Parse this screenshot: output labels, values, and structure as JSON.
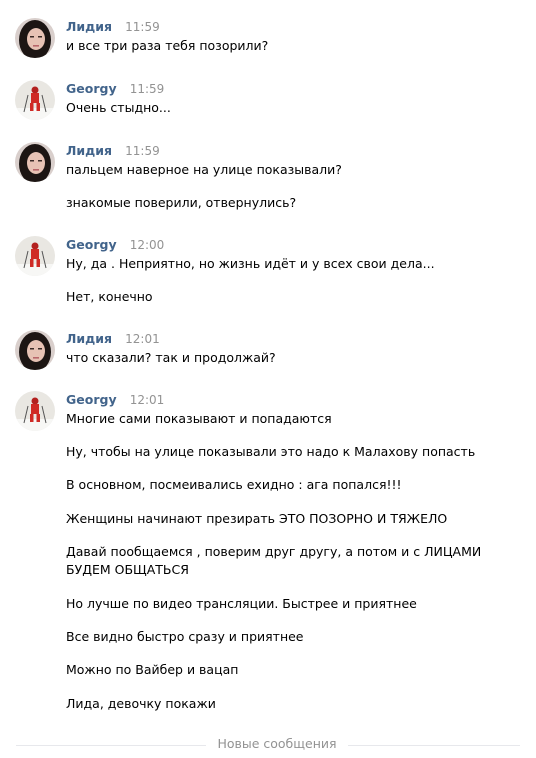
{
  "messages": [
    {
      "author": "Лидия",
      "time": "11:59",
      "avatar_icon": "avatar-woman-icon",
      "lines": [
        "и все три раза тебя позорили?"
      ]
    },
    {
      "author": "Georgy",
      "time": "11:59",
      "avatar_icon": "avatar-skier-icon",
      "lines": [
        "Очень стыдно..."
      ]
    },
    {
      "author": "Лидия",
      "time": "11:59",
      "avatar_icon": "avatar-woman-icon",
      "lines": [
        "пальцем наверное на улице показывали?",
        "знакомые поверили, отвернулись?"
      ]
    },
    {
      "author": "Georgy",
      "time": "12:00",
      "avatar_icon": "avatar-skier-icon",
      "lines": [
        "Ну, да . Неприятно, но жизнь идёт и у всех свои дела...",
        "Нет, конечно"
      ]
    },
    {
      "author": "Лидия",
      "time": "12:01",
      "avatar_icon": "avatar-woman-icon",
      "lines": [
        "что сказали? так и продолжай?"
      ]
    },
    {
      "author": "Georgy",
      "time": "12:01",
      "avatar_icon": "avatar-skier-icon",
      "lines": [
        "Многие сами показывают и попадаются",
        "Ну, чтобы на улице показывали это надо к Малахову попасть",
        "В основном, посмеивались ехидно : ага попался!!!",
        "Женщины начинают презирать ЭТО ПОЗОРНО И ТЯЖЕЛО",
        "Давай пообщаемся , поверим друг другу, а потом и с ЛИЦАМИ",
        "БУДЕМ ОБЩАТЬСЯ",
        "Но лучше по видео трансляции. Быстрее и приятнее",
        "Все видно быстро сразу и приятнее",
        "Можно по Вайбер и вацап",
        "Лида, девочку покажи"
      ]
    }
  ],
  "divider": {
    "label": "Новые сообщения"
  },
  "colors": {
    "author": "#42648b",
    "time": "#939393",
    "text": "#000000",
    "divider": "#e7e8ec"
  }
}
